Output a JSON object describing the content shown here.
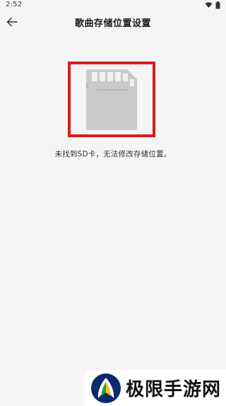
{
  "status_bar": {
    "time": "2:52",
    "icons": [
      "wifi-icon",
      "battery-icon"
    ]
  },
  "header": {
    "title": "歌曲存储位置设置",
    "back_icon": "back-arrow-icon"
  },
  "main": {
    "illustration": "sd-card-icon",
    "message": "未找到SD卡，无法修改存储位置。"
  },
  "watermark": {
    "text": "极限手游网"
  },
  "colors": {
    "highlight_border": "#d81e1e",
    "card": "#c9cacb",
    "background": "#f5f5f5"
  }
}
